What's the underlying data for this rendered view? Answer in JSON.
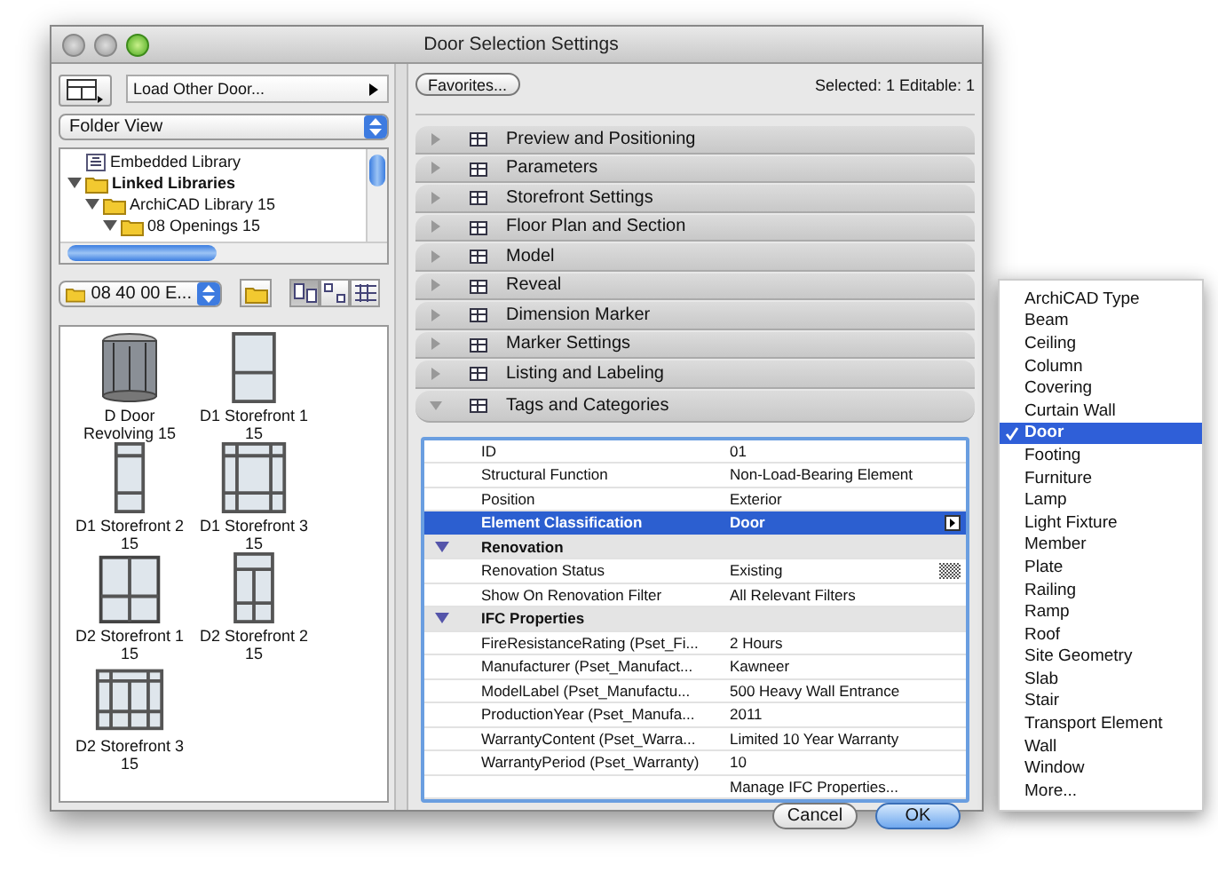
{
  "window": {
    "title": "Door Selection Settings"
  },
  "left": {
    "load_button": "Load Other Door...",
    "view_select": "Folder View",
    "tree": [
      {
        "label": "Embedded Library",
        "kind": "library",
        "bold": false
      },
      {
        "label": "Linked Libraries",
        "kind": "folder",
        "bold": true,
        "expanded": true,
        "children": [
          {
            "label": "ArchiCAD Library 15",
            "kind": "folder",
            "bold": false,
            "expanded": true,
            "children": [
              {
                "label": "08 Openings 15",
                "kind": "folder",
                "bold": false,
                "expanded": true
              }
            ]
          }
        ]
      }
    ],
    "folder_select": "08 40 00 E...",
    "view_modes": [
      {
        "selected": true
      },
      {
        "selected": false
      },
      {
        "selected": false
      }
    ],
    "items": [
      {
        "label": "D Door\nRevolving 15",
        "kind": "revolving"
      },
      {
        "label": "D1 Storefront 1\n15",
        "kind": "tall"
      },
      {
        "label": "D1 Storefront 2\n15",
        "kind": "narrow"
      },
      {
        "label": "D1 Storefront 3\n15",
        "kind": "grid"
      },
      {
        "label": "D2 Storefront 1\n15",
        "kind": "double"
      },
      {
        "label": "D2 Storefront 2\n15",
        "kind": "transom"
      },
      {
        "label": "D2 Storefront 3\n15",
        "kind": "wide"
      }
    ]
  },
  "right": {
    "favorites_button": "Favorites...",
    "selection_info": "Selected: 1 Editable: 1",
    "sections": [
      {
        "label": "Preview and Positioning",
        "expanded": false
      },
      {
        "label": "Parameters",
        "expanded": false
      },
      {
        "label": "Storefront Settings",
        "expanded": false
      },
      {
        "label": "Floor Plan and Section",
        "expanded": false
      },
      {
        "label": "Model",
        "expanded": false
      },
      {
        "label": "Reveal",
        "expanded": false
      },
      {
        "label": "Dimension Marker",
        "expanded": false
      },
      {
        "label": "Marker Settings",
        "expanded": false
      },
      {
        "label": "Listing and Labeling",
        "expanded": false
      },
      {
        "label": "Tags and Categories",
        "expanded": true
      }
    ],
    "table": {
      "rows": [
        {
          "kind": "field",
          "name": "ID",
          "value": "01",
          "selected": false
        },
        {
          "kind": "field",
          "name": "Structural Function",
          "value": "Non-Load-Bearing Element",
          "selected": false
        },
        {
          "kind": "field",
          "name": "Position",
          "value": "Exterior",
          "selected": false
        },
        {
          "kind": "field",
          "name": "Element Classification",
          "value": "Door",
          "selected": true,
          "menu": true
        },
        {
          "kind": "group",
          "name": "Renovation",
          "expanded": true
        },
        {
          "kind": "field",
          "name": "Renovation Status",
          "value": "Existing",
          "selected": false,
          "swatch": true
        },
        {
          "kind": "field",
          "name": "Show On Renovation Filter",
          "value": "All Relevant Filters",
          "selected": false
        },
        {
          "kind": "group",
          "name": "IFC Properties",
          "expanded": true
        },
        {
          "kind": "field",
          "name": "FireResistanceRating (Pset_Fi...",
          "value": "2 Hours",
          "selected": false
        },
        {
          "kind": "field",
          "name": "Manufacturer (Pset_Manufact...",
          "value": "Kawneer",
          "selected": false
        },
        {
          "kind": "field",
          "name": "ModelLabel (Pset_Manufactu...",
          "value": "500 Heavy Wall Entrance",
          "selected": false
        },
        {
          "kind": "field",
          "name": "ProductionYear (Pset_Manufa...",
          "value": "2011",
          "selected": false
        },
        {
          "kind": "field",
          "name": "WarrantyContent (Pset_Warra...",
          "value": "Limited 10 Year Warranty",
          "selected": false
        },
        {
          "kind": "field",
          "name": "WarrantyPeriod (Pset_Warranty)",
          "value": "10",
          "selected": false
        },
        {
          "kind": "action",
          "value": "Manage IFC Properties..."
        }
      ]
    },
    "buttons": [
      {
        "label": "Cancel",
        "default": false
      },
      {
        "label": "OK",
        "default": true
      }
    ]
  },
  "menu": {
    "items": [
      {
        "label": "ArchiCAD Type",
        "selected": false
      },
      {
        "label": "Beam",
        "selected": false
      },
      {
        "label": "Ceiling",
        "selected": false
      },
      {
        "label": "Column",
        "selected": false
      },
      {
        "label": "Covering",
        "selected": false
      },
      {
        "label": "Curtain Wall",
        "selected": false
      },
      {
        "label": "Door",
        "selected": true
      },
      {
        "label": "Footing",
        "selected": false
      },
      {
        "label": "Furniture",
        "selected": false
      },
      {
        "label": "Lamp",
        "selected": false
      },
      {
        "label": "Light Fixture",
        "selected": false
      },
      {
        "label": "Member",
        "selected": false
      },
      {
        "label": "Plate",
        "selected": false
      },
      {
        "label": "Railing",
        "selected": false
      },
      {
        "label": "Ramp",
        "selected": false
      },
      {
        "label": "Roof",
        "selected": false
      },
      {
        "label": "Site Geometry",
        "selected": false
      },
      {
        "label": "Slab",
        "selected": false
      },
      {
        "label": "Stair",
        "selected": false
      },
      {
        "label": "Transport Element",
        "selected": false
      },
      {
        "label": "Wall",
        "selected": false
      },
      {
        "label": "Window",
        "selected": false
      },
      {
        "label": "More...",
        "selected": false
      }
    ]
  }
}
